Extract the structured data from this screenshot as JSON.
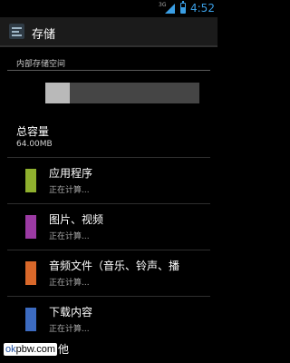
{
  "status_bar": {
    "network": "3G",
    "time": "4:52",
    "accent": "#3a9ee4"
  },
  "action_bar": {
    "icon": "storage-settings-icon",
    "title": "存储"
  },
  "internal_storage": {
    "section_title": "内部存储空间",
    "used_fraction": 0.16,
    "total_label": "总容量",
    "total_value": "64.00MB"
  },
  "categories": [
    {
      "label": "应用程序",
      "status": "正在计算...",
      "color": "#8fb02e"
    },
    {
      "label": "图片、视频",
      "status": "正在计算...",
      "color": "#9b3aa3"
    },
    {
      "label": "音频文件（音乐、铃声、播",
      "status": "正在计算...",
      "color": "#d9682a"
    },
    {
      "label": "下载内容",
      "status": "正在计算...",
      "color": "#3c6bc1"
    }
  ],
  "bottom": {
    "watermark_brand": "ok",
    "watermark_rest": "pbw.com",
    "partial_text": "他"
  }
}
